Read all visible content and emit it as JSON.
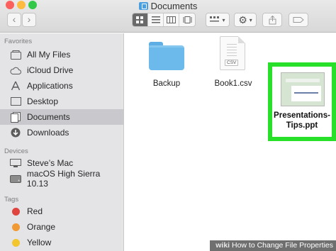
{
  "window": {
    "title": "Documents"
  },
  "toolbar": {
    "back": "‹",
    "forward": "›",
    "view_icons": [
      "grid-view-icon",
      "list-view-icon",
      "column-view-icon",
      "gallery-view-icon"
    ],
    "group_icon": "group-icon",
    "action_icon": "gear-icon",
    "share_icon": "share-icon",
    "tag_icon": "tag-icon"
  },
  "sidebar": {
    "favorites_header": "Favorites",
    "favorites": [
      {
        "label": "All My Files",
        "icon": "all-files-icon"
      },
      {
        "label": "iCloud Drive",
        "icon": "cloud-icon"
      },
      {
        "label": "Applications",
        "icon": "applications-icon"
      },
      {
        "label": "Desktop",
        "icon": "desktop-icon"
      },
      {
        "label": "Documents",
        "icon": "documents-icon",
        "selected": true
      },
      {
        "label": "Downloads",
        "icon": "downloads-icon"
      }
    ],
    "devices_header": "Devices",
    "devices": [
      {
        "label": "Steve’s Mac",
        "icon": "computer-icon"
      },
      {
        "label": "macOS High Sierra 10.13",
        "icon": "disk-icon"
      }
    ],
    "tags_header": "Tags",
    "tags": [
      {
        "label": "Red",
        "color": "#e0443e"
      },
      {
        "label": "Orange",
        "color": "#f09a36"
      },
      {
        "label": "Yellow",
        "color": "#f3c62e"
      }
    ]
  },
  "files": [
    {
      "name": "Backup",
      "kind": "folder"
    },
    {
      "name": "Book1.csv",
      "kind": "document",
      "ext": "CSV"
    },
    {
      "name_line1": "Presentations-",
      "name_line2": "Tips.ppt",
      "kind": "presentation",
      "highlighted": true
    }
  ],
  "colors": {
    "highlight": "#28e02a",
    "close": "#fc605c",
    "minimize": "#fdbc40",
    "zoom": "#34c84a"
  },
  "watermark": {
    "brand": "wiki",
    "text": "How to Change File Properties"
  }
}
